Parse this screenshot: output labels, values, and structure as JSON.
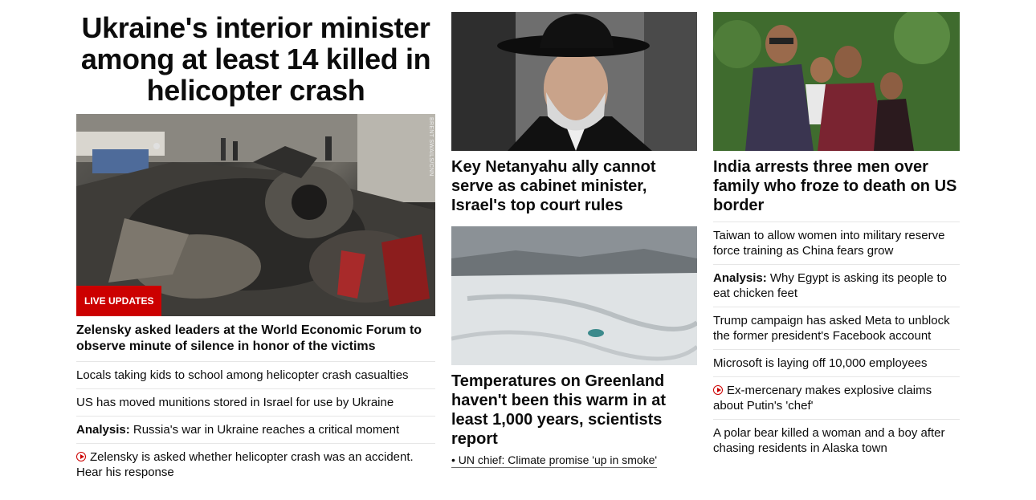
{
  "left": {
    "headline": "Ukraine's interior minister among at least 14 killed in helicopter crash",
    "photo_credit": "BRENT SWAILS/CNN",
    "badge": "LIVE UPDATES",
    "lead": "Zelensky asked leaders at the World Economic Forum to observe minute of silence in honor of the victims",
    "items": [
      {
        "prefix": "",
        "text": "Locals taking kids to school among helicopter crash casualties",
        "video": false
      },
      {
        "prefix": "",
        "text": "US has moved munitions stored in Israel for use by Ukraine",
        "video": false
      },
      {
        "prefix": "Analysis:",
        "text": "Russia's war in Ukraine reaches a critical moment",
        "video": false
      },
      {
        "prefix": "",
        "text": "Zelensky is asked whether helicopter crash was an accident. Hear his response",
        "video": true
      }
    ]
  },
  "middle": {
    "story1": "Key Netanyahu ally cannot serve as cabinet minister, Israel's top court rules",
    "story2": "Temperatures on Greenland haven't been this warm in at least 1,000 years, scientists report",
    "story2_link": "• UN chief: Climate promise 'up in smoke'"
  },
  "right": {
    "story1": "India arrests three men over family who froze to death on US border",
    "items": [
      {
        "prefix": "",
        "text": "Taiwan to allow women into military reserve force training as China fears grow",
        "video": false
      },
      {
        "prefix": "Analysis:",
        "text": "Why Egypt is asking its people to eat chicken feet",
        "video": false
      },
      {
        "prefix": "",
        "text": "Trump campaign has asked Meta to unblock the former president's Facebook account",
        "video": false
      },
      {
        "prefix": "",
        "text": "Microsoft is laying off 10,000 employees",
        "video": false
      },
      {
        "prefix": "",
        "text": "Ex-mercenary makes explosive claims about Putin's 'chef'",
        "video": true
      },
      {
        "prefix": "",
        "text": "A polar bear killed a woman and a boy after chasing residents in Alaska town",
        "video": false
      }
    ]
  },
  "colors": {
    "accent": "#cc0000",
    "text": "#0c0c0c",
    "divider": "#e6e6e6"
  }
}
